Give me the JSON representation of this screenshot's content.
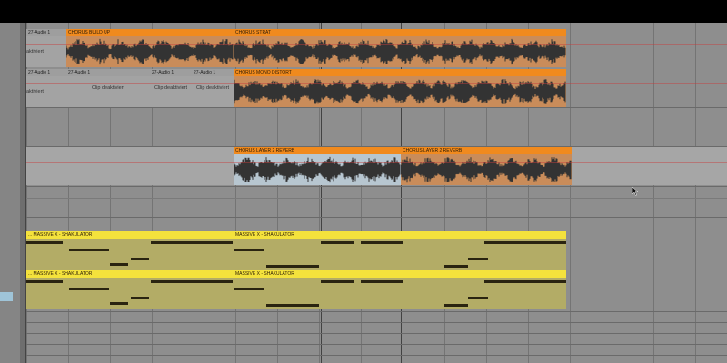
{
  "tracks": [
    {
      "id": "t1",
      "clips": [
        {
          "type": "gray",
          "label": "27-Audio 1",
          "left_text": "aktiviert"
        },
        {
          "type": "audio",
          "label": "CHORUS BUILD UP"
        },
        {
          "type": "audio",
          "label": "CHORUS STRAT"
        }
      ]
    },
    {
      "id": "t2",
      "clips": [
        {
          "type": "gray",
          "label": "27-Audio 1",
          "left_text": "aktiviert"
        },
        {
          "type": "gray",
          "label": "27-Audio 1",
          "body_text": "Clip deaktiviert"
        },
        {
          "type": "gray",
          "label": "27-Audio 1",
          "body_text": "Clip deaktiviert"
        },
        {
          "type": "gray",
          "label": "27-Audio 1",
          "body_text": "Clip deaktiviert"
        },
        {
          "type": "audio",
          "label": "CHORUS MONO DISTORT"
        }
      ]
    },
    {
      "id": "t3",
      "clips": [
        {
          "type": "audio-light",
          "label": "CHORUS LAYER 2 REVERB"
        },
        {
          "type": "audio",
          "label": "CHORUS LAYER 2 REVERB"
        }
      ]
    },
    {
      "id": "t4",
      "clips": [
        {
          "type": "midi",
          "label": "... MASSIVE X - SHAKULATOR"
        },
        {
          "type": "midi",
          "label": "MASSIVE X - SHAKULATOR"
        }
      ]
    },
    {
      "id": "t5",
      "clips": [
        {
          "type": "midi",
          "label": "... MASSIVE X - SHAKULATOR"
        },
        {
          "type": "midi",
          "label": "MASSIVE X - SHAKULATOR"
        }
      ]
    }
  ],
  "colors": {
    "audio_header": "#f08a1e",
    "audio_body": "#c98c5a",
    "midi_header": "#f4e23c",
    "midi_body": "#b3ac66",
    "deactivated_clip": "#a3a3a3",
    "waveform": "#333333"
  },
  "icons": [
    "mouse-pointer-icon"
  ]
}
